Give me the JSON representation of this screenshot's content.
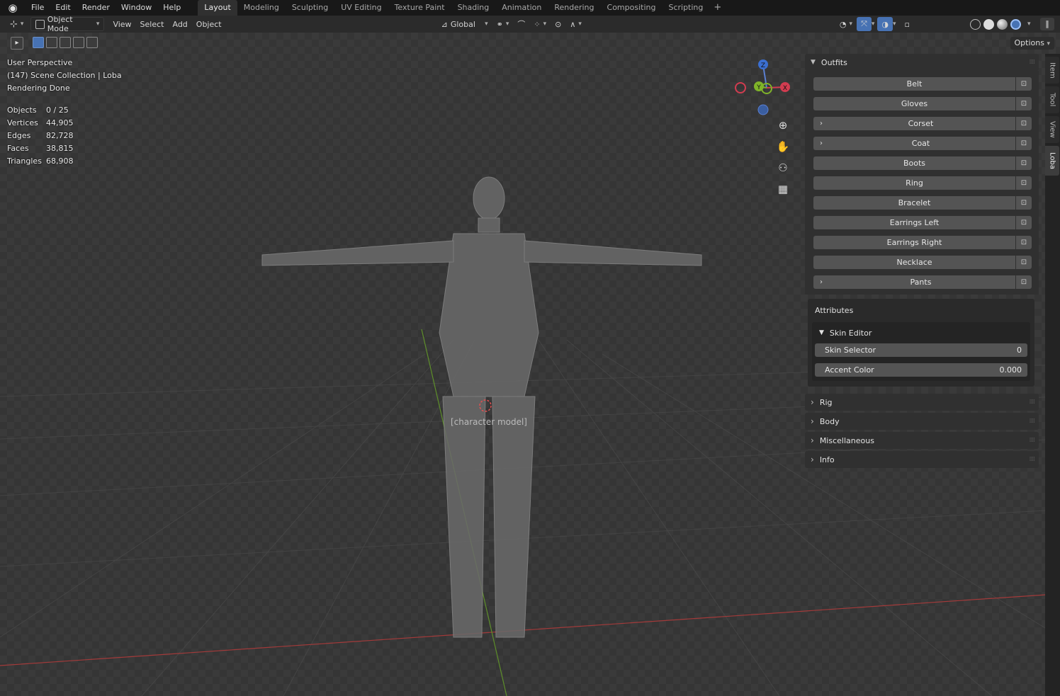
{
  "topbar": {
    "menus": [
      "File",
      "Edit",
      "Render",
      "Window",
      "Help"
    ],
    "workspaces": [
      "Layout",
      "Modeling",
      "Sculpting",
      "UV Editing",
      "Texture Paint",
      "Shading",
      "Animation",
      "Rendering",
      "Compositing",
      "Scripting"
    ],
    "active_workspace": "Layout",
    "add_label": "+"
  },
  "header": {
    "mode": "Object Mode",
    "menus": [
      "View",
      "Select",
      "Add",
      "Object"
    ],
    "orientation": "Global",
    "options": "Options"
  },
  "overlay": {
    "perspective": "User Perspective",
    "collection": "(147) Scene Collection | Loba",
    "status": "Rendering Done",
    "stats": [
      {
        "k": "Objects",
        "v": "0 / 25"
      },
      {
        "k": "Vertices",
        "v": "44,905"
      },
      {
        "k": "Edges",
        "v": "82,728"
      },
      {
        "k": "Faces",
        "v": "38,815"
      },
      {
        "k": "Triangles",
        "v": "68,908"
      }
    ],
    "placeholder_note": "[character model]"
  },
  "gizmo": {
    "z": "Z",
    "y": "Y",
    "x": "X"
  },
  "npanel": {
    "outfits_title": "Outfits",
    "outfits": [
      {
        "label": "Belt",
        "expandable": false
      },
      {
        "label": "Gloves",
        "expandable": false
      },
      {
        "label": "Corset",
        "expandable": true
      },
      {
        "label": "Coat",
        "expandable": true
      },
      {
        "label": "Boots",
        "expandable": false
      },
      {
        "label": "Ring",
        "expandable": false
      },
      {
        "label": "Bracelet",
        "expandable": false
      },
      {
        "label": "Earrings Left",
        "expandable": false
      },
      {
        "label": "Earrings Right",
        "expandable": false
      },
      {
        "label": "Necklace",
        "expandable": false
      },
      {
        "label": "Pants",
        "expandable": true
      }
    ],
    "attributes_title": "Attributes",
    "skin_editor_title": "Skin Editor",
    "skin_selector": {
      "label": "Skin Selector",
      "value": "0"
    },
    "accent_color": {
      "label": "Accent Color",
      "value": "0.000"
    },
    "collapsed_panels": [
      "Rig",
      "Body",
      "Miscellaneous",
      "Info"
    ]
  },
  "sidetabs": [
    "Item",
    "Tool",
    "View",
    "Loba"
  ],
  "active_sidetab": "Loba"
}
